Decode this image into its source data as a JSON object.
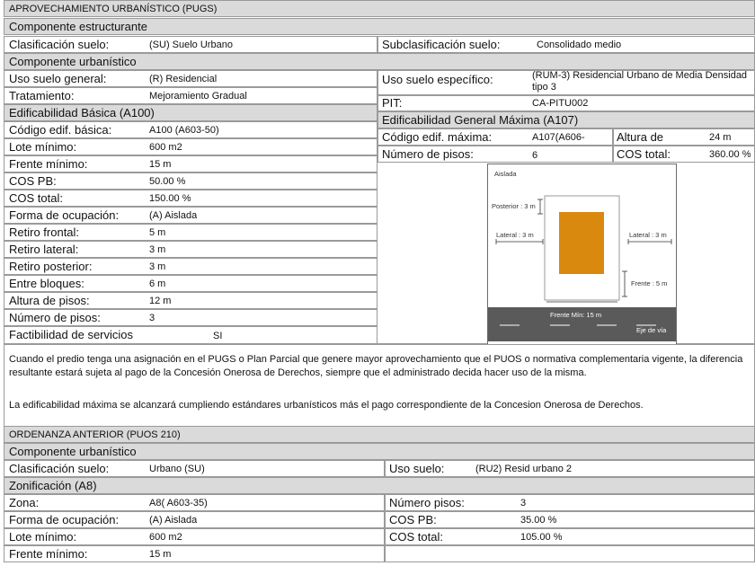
{
  "pugs": {
    "title": "APROVECHAMIENTO URBANÍSTICO (PUGS)",
    "componente_estructurante": "Componente  estructurante",
    "clasificacion_label": "Clasificación suelo:",
    "clasificacion_value": "(SU) Suelo Urbano",
    "subclasificacion_label": "Subclasificación suelo:",
    "subclasificacion_value": "Consolidado medio",
    "componente_urbanistico": "Componente  urbanístico",
    "uso_general_label": "Uso suelo general:",
    "uso_general_value": "(R) Residencial",
    "uso_especifico_label": "Uso suelo específico:",
    "uso_especifico_value": "(RUM-3) Residencial Urbano de Media Densidad tipo 3",
    "tratamiento_label": "Tratamiento:",
    "tratamiento_value": "Mejoramiento Gradual",
    "pit_label": "PIT:",
    "pit_value": "CA-PITU002",
    "edif_basica_title": "Edificabilidad Básica (A100)",
    "edif_maxima_title": "Edificabilidad General Máxima (A107)",
    "basica_rows": [
      {
        "label": "Código edif. básica:",
        "value": "A100 (A603-50)"
      },
      {
        "label": "Lote mínimo:",
        "value": "600 m2"
      },
      {
        "label": "Frente mínimo:",
        "value": "15 m"
      },
      {
        "label": "COS PB:",
        "value": "50.00 %"
      },
      {
        "label": "COS total:",
        "value": "150.00 %"
      },
      {
        "label": "Forma de ocupación:",
        "value": "(A) Aislada"
      },
      {
        "label": "Retiro frontal:",
        "value": "5 m"
      },
      {
        "label": "Retiro lateral:",
        "value": "3 m"
      },
      {
        "label": "Retiro posterior:",
        "value": "3 m"
      },
      {
        "label": "Entre bloques:",
        "value": "6 m"
      },
      {
        "label": "Altura de pisos:",
        "value": "12 m"
      },
      {
        "label": "Número de pisos:",
        "value": "3"
      },
      {
        "label": "Factibilidad de servicios",
        "value": "SI"
      }
    ],
    "codigo_maxima_label": "Código edif. máxima:",
    "codigo_maxima_value": "A107(A606-",
    "altura_label": "Altura de",
    "altura_value": "24 m",
    "pisos_label": "Número de pisos:",
    "pisos_value": "6",
    "cos_total_label": "COS total:",
    "cos_total_value": "360.00 %",
    "diagram": {
      "aislada": "Aislada",
      "posterior": "Posterior : 3 m",
      "lateral_left": "Lateral : 3 m",
      "lateral_right": "Lateral : 3 m",
      "frente": "Frente : 5 m",
      "frente_min": "Frente Mín: 15 m",
      "eje_via": "Eje de vía",
      "building_color": "#d98a0e",
      "road_color": "#5a5a5a"
    },
    "note_1": "Cuando el predio tenga una asignación en el PUGS o Plan Parcial que genere mayor aprovechamiento que el PUOS o normativa complementaria vigente, la diferencia resultante estará sujeta al pago de la Concesión Onerosa de Derechos, siempre que el administrado decida hacer uso de la misma.",
    "note_2": "La edificabilidad máxima se alcanzará cumpliendo estándares urbanísticos más el pago correspondiente de la Concesion Onerosa de Derechos."
  },
  "puos": {
    "title": "ORDENANZA ANTERIOR (PUOS 210)",
    "componente_urbanistico": "Componente urbanístico",
    "clasificacion_label": "Clasificación suelo:",
    "clasificacion_value": "Urbano (SU)",
    "uso_label": "Uso suelo:",
    "uso_value": "(RU2) Resid urbano 2",
    "zonificacion_title": "Zonificación (A8)",
    "left_rows": [
      {
        "label": "Zona:",
        "value": "A8( A603-35)"
      },
      {
        "label": "Forma de ocupación:",
        "value": "(A) Aislada"
      },
      {
        "label": "Lote mínimo:",
        "value": "600 m2"
      },
      {
        "label": "Frente mínimo:",
        "value": "15 m"
      }
    ],
    "right_rows": [
      {
        "label": "Número pisos:",
        "value": "3"
      },
      {
        "label": "COS PB:",
        "value": "35.00 %"
      },
      {
        "label": "COS total:",
        "value": "105.00 %"
      }
    ]
  }
}
